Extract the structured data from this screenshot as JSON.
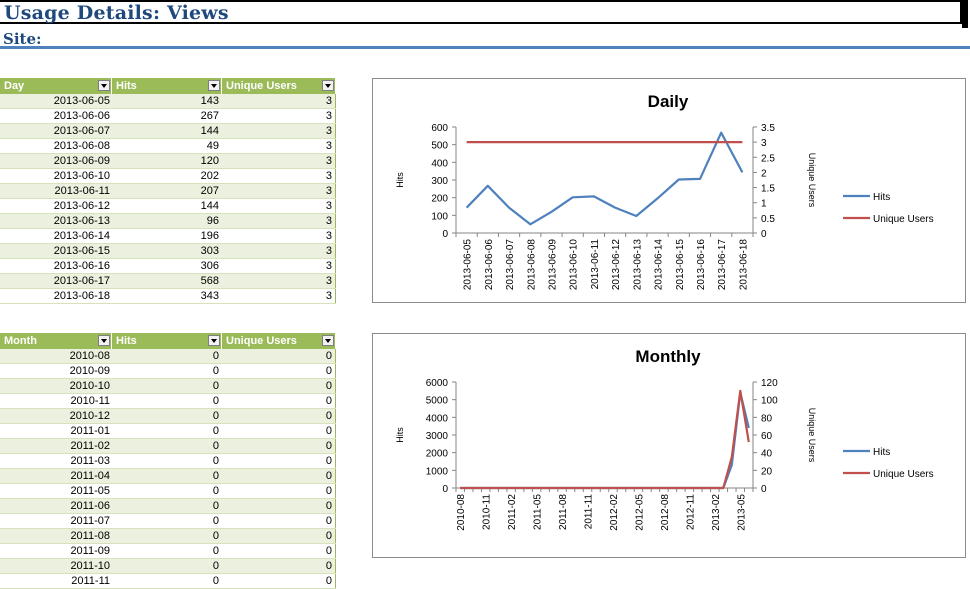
{
  "header": {
    "title": "Usage Details: Views",
    "site_label": "Site:"
  },
  "daily_table": {
    "headers": [
      "Day",
      "Hits",
      "Unique Users"
    ],
    "rows": [
      [
        "2013-06-05",
        "143",
        "3"
      ],
      [
        "2013-06-06",
        "267",
        "3"
      ],
      [
        "2013-06-07",
        "144",
        "3"
      ],
      [
        "2013-06-08",
        "49",
        "3"
      ],
      [
        "2013-06-09",
        "120",
        "3"
      ],
      [
        "2013-06-10",
        "202",
        "3"
      ],
      [
        "2013-06-11",
        "207",
        "3"
      ],
      [
        "2013-06-12",
        "144",
        "3"
      ],
      [
        "2013-06-13",
        "96",
        "3"
      ],
      [
        "2013-06-14",
        "196",
        "3"
      ],
      [
        "2013-06-15",
        "303",
        "3"
      ],
      [
        "2013-06-16",
        "306",
        "3"
      ],
      [
        "2013-06-17",
        "568",
        "3"
      ],
      [
        "2013-06-18",
        "343",
        "3"
      ]
    ]
  },
  "monthly_table": {
    "headers": [
      "Month",
      "Hits",
      "Unique Users"
    ],
    "rows": [
      [
        "2010-08",
        "0",
        "0"
      ],
      [
        "2010-09",
        "0",
        "0"
      ],
      [
        "2010-10",
        "0",
        "0"
      ],
      [
        "2010-11",
        "0",
        "0"
      ],
      [
        "2010-12",
        "0",
        "0"
      ],
      [
        "2011-01",
        "0",
        "0"
      ],
      [
        "2011-02",
        "0",
        "0"
      ],
      [
        "2011-03",
        "0",
        "0"
      ],
      [
        "2011-04",
        "0",
        "0"
      ],
      [
        "2011-05",
        "0",
        "0"
      ],
      [
        "2011-06",
        "0",
        "0"
      ],
      [
        "2011-07",
        "0",
        "0"
      ],
      [
        "2011-08",
        "0",
        "0"
      ],
      [
        "2011-09",
        "0",
        "0"
      ],
      [
        "2011-10",
        "0",
        "0"
      ],
      [
        "2011-11",
        "0",
        "0"
      ]
    ]
  },
  "colors": {
    "hits": "#4f81bd",
    "unique_users": "#c0504d",
    "header_green": "#9bbb59",
    "title_blue": "#1f497d"
  },
  "chart_data": [
    {
      "type": "line",
      "title": "Daily",
      "xlabel": "",
      "ylabel": "Hits",
      "y2label": "Unique Users",
      "ylim": [
        0,
        600
      ],
      "yticks": [
        0,
        100,
        200,
        300,
        400,
        500,
        600
      ],
      "y2lim": [
        0,
        3.5
      ],
      "y2ticks": [
        "0",
        "0.5",
        "1",
        "1.5",
        "2",
        "2.5",
        "3",
        "3.5"
      ],
      "legend": "right",
      "x": [
        "2013-06-05",
        "2013-06-06",
        "2013-06-07",
        "2013-06-08",
        "2013-06-09",
        "2013-06-10",
        "2013-06-11",
        "2013-06-12",
        "2013-06-13",
        "2013-06-14",
        "2013-06-15",
        "2013-06-16",
        "2013-06-17",
        "2013-06-18"
      ],
      "series": [
        {
          "name": "Hits",
          "axis": "left",
          "values": [
            143,
            267,
            144,
            49,
            120,
            202,
            207,
            144,
            96,
            196,
            303,
            306,
            568,
            343
          ]
        },
        {
          "name": "Unique Users",
          "axis": "right",
          "values": [
            3,
            3,
            3,
            3,
            3,
            3,
            3,
            3,
            3,
            3,
            3,
            3,
            3,
            3
          ]
        }
      ]
    },
    {
      "type": "line",
      "title": "Monthly",
      "xlabel": "",
      "ylabel": "Hits",
      "y2label": "Unique Users",
      "ylim": [
        0,
        6000
      ],
      "yticks": [
        0,
        1000,
        2000,
        3000,
        4000,
        5000,
        6000
      ],
      "y2lim": [
        0,
        120
      ],
      "y2ticks": [
        "0",
        "20",
        "40",
        "60",
        "80",
        "100",
        "120"
      ],
      "legend": "right",
      "x": [
        "2010-08",
        "2010-09",
        "2010-10",
        "2010-11",
        "2010-12",
        "2011-01",
        "2011-02",
        "2011-03",
        "2011-04",
        "2011-05",
        "2011-06",
        "2011-07",
        "2011-08",
        "2011-09",
        "2011-10",
        "2011-11",
        "2011-12",
        "2012-01",
        "2012-02",
        "2012-03",
        "2012-04",
        "2012-05",
        "2012-06",
        "2012-07",
        "2012-08",
        "2012-09",
        "2012-10",
        "2012-11",
        "2012-12",
        "2013-01",
        "2013-02",
        "2013-03",
        "2013-04",
        "2013-05",
        "2013-06"
      ],
      "xticks": [
        "2010-08",
        "2010-11",
        "2011-02",
        "2011-05",
        "2011-08",
        "2011-11",
        "2012-02",
        "2012-05",
        "2012-08",
        "2012-11",
        "2013-02",
        "2013-05"
      ],
      "series": [
        {
          "name": "Hits",
          "axis": "left",
          "values": [
            0,
            0,
            0,
            0,
            0,
            0,
            0,
            0,
            0,
            0,
            0,
            0,
            0,
            0,
            0,
            0,
            0,
            0,
            0,
            0,
            0,
            0,
            0,
            0,
            0,
            0,
            0,
            0,
            0,
            0,
            0,
            0,
            1300,
            5400,
            3400
          ]
        },
        {
          "name": "Unique Users",
          "axis": "right",
          "values": [
            0,
            0,
            0,
            0,
            0,
            0,
            0,
            0,
            0,
            0,
            0,
            0,
            0,
            0,
            0,
            0,
            0,
            0,
            0,
            0,
            0,
            0,
            0,
            0,
            0,
            0,
            0,
            0,
            0,
            0,
            0,
            0,
            35,
            110,
            52
          ]
        }
      ]
    }
  ]
}
